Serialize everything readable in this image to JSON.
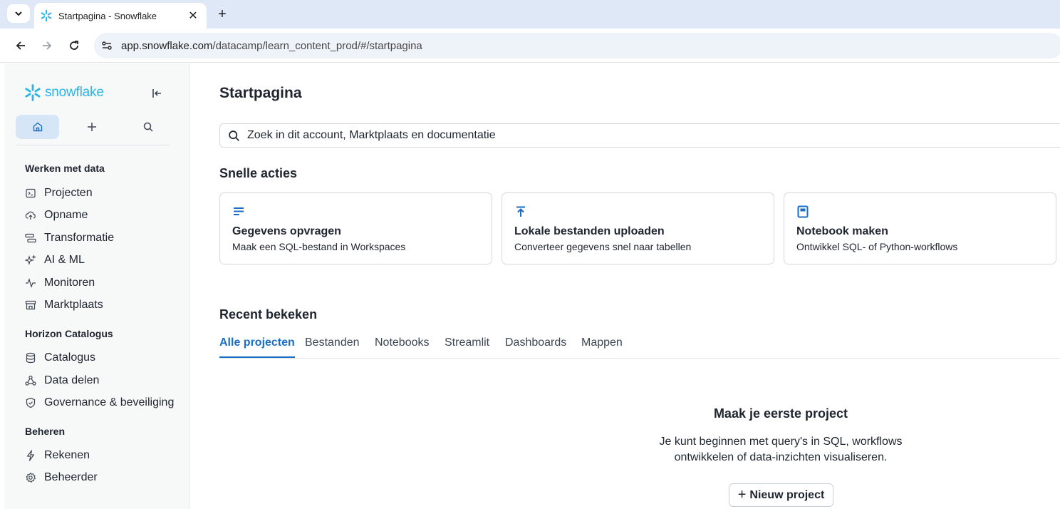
{
  "browser": {
    "tab_title": "Startpagina - Snowflake",
    "url_host": "app.snowflake.com",
    "url_path": "/datacamp/learn_content_prod/#/startpagina",
    "icons": [
      "tab-list-icon",
      "snowflake-favicon-icon",
      "close-icon",
      "plus-icon",
      "back-icon",
      "forward-icon",
      "reload-icon",
      "site-info-icon"
    ]
  },
  "sidebar": {
    "logo_text": "snowflake",
    "sections": [
      {
        "title": "Werken met data",
        "items": [
          {
            "label": "Projecten",
            "icon": "terminal-icon"
          },
          {
            "label": "Opname",
            "icon": "cloud-upload-icon"
          },
          {
            "label": "Transformatie",
            "icon": "transform-icon"
          },
          {
            "label": "AI & ML",
            "icon": "sparkle-icon"
          },
          {
            "label": "Monitoren",
            "icon": "activity-icon"
          },
          {
            "label": "Marktplaats",
            "icon": "storefront-icon"
          }
        ]
      },
      {
        "title": "Horizon Catalogus",
        "items": [
          {
            "label": "Catalogus",
            "icon": "database-icon"
          },
          {
            "label": "Data delen",
            "icon": "share-icon"
          },
          {
            "label": "Governance & beveiliging",
            "icon": "shield-icon"
          }
        ]
      },
      {
        "title": "Beheren",
        "items": [
          {
            "label": "Rekenen",
            "icon": "lightning-icon"
          },
          {
            "label": "Beheerder",
            "icon": "gear-icon"
          }
        ]
      }
    ]
  },
  "main": {
    "title": "Startpagina",
    "search_placeholder": "Zoek in dit account, Marktplaats en documentatie",
    "quick_actions_title": "Snelle acties",
    "quick_actions": [
      {
        "title": "Gegevens opvragen",
        "desc": "Maak een SQL-bestand in Workspaces",
        "icon": "sql-lines-icon"
      },
      {
        "title": "Lokale bestanden uploaden",
        "desc": "Converteer gegevens snel naar tabellen",
        "icon": "upload-icon"
      },
      {
        "title": "Notebook maken",
        "desc": "Ontwikkel SQL- of Python-workflows",
        "icon": "notebook-icon"
      }
    ],
    "recent_title": "Recent bekeken",
    "tabs": [
      "Alle projecten",
      "Bestanden",
      "Notebooks",
      "Streamlit",
      "Dashboards",
      "Mappen"
    ],
    "active_tab": "Alle projecten",
    "empty_title": "Maak je eerste project",
    "empty_line1": "Je kunt beginnen met query's in SQL, workflows",
    "empty_line2": "ontwikkelen of data-inzichten visualiseren.",
    "new_project_label": "Nieuw project"
  },
  "colors": {
    "accent": "#1a6ec6",
    "brand": "#29b5e8",
    "active_nav_bg": "#d6e6f7"
  }
}
